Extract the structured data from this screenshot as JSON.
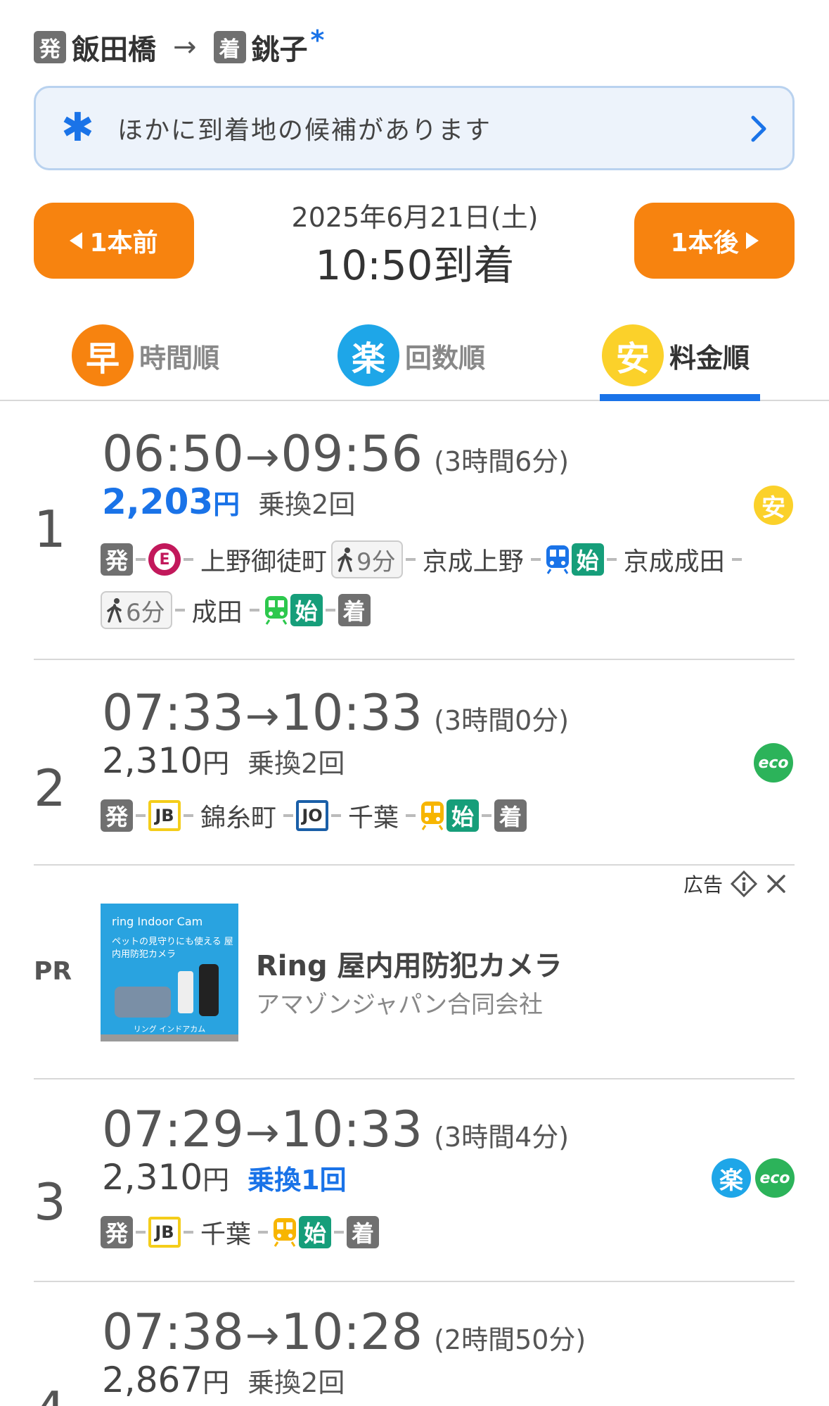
{
  "header": {
    "dep_badge": "発",
    "from": "飯田橋",
    "arrow": "→",
    "arr_badge": "着",
    "to": "銚子",
    "star": "*"
  },
  "banner": {
    "icon": "asterisk-icon",
    "text": "ほかに到着地の候補があります"
  },
  "nav": {
    "prev_label": "1本前",
    "next_label": "1本後",
    "date": "2025年6月21日(土)",
    "arrival": "10:50到着"
  },
  "tabs": [
    {
      "icon_char": "早",
      "label": "時間順",
      "color": "#f7830f"
    },
    {
      "icon_char": "楽",
      "label": "回数順",
      "color": "#1ea6e8"
    },
    {
      "icon_char": "安",
      "label": "料金順",
      "color": "#fbd12a",
      "active": true
    }
  ],
  "routes": [
    {
      "num": "1",
      "dep": "06:50",
      "arrow": "→",
      "arr": "09:56",
      "duration": "(3時間6分)",
      "fare": "2,203",
      "yen": "円",
      "transfers": "乗換2回",
      "tags": [
        "安"
      ],
      "seg_line1": {
        "dep": "発",
        "e_line": "E",
        "st1": "上野御徒町",
        "walk1": "9分",
        "st2": "京成上野",
        "start": "始",
        "st3": "京成成田"
      },
      "seg_line2": {
        "walk2": "6分",
        "st4": "成田",
        "start": "始",
        "arr": "着"
      }
    },
    {
      "num": "2",
      "dep": "07:33",
      "arrow": "→",
      "arr": "10:33",
      "duration": "(3時間0分)",
      "fare": "2,310",
      "yen": "円",
      "transfers": "乗換2回",
      "tags": [
        "eco"
      ],
      "seg": {
        "dep": "発",
        "jb": "JB",
        "st1": "錦糸町",
        "jo": "JO",
        "st2": "千葉",
        "start": "始",
        "arr": "着"
      }
    },
    {
      "num": "3",
      "dep": "07:29",
      "arrow": "→",
      "arr": "10:33",
      "duration": "(3時間4分)",
      "fare": "2,310",
      "yen": "円",
      "transfers": "乗換1回",
      "tags": [
        "楽",
        "eco"
      ],
      "seg": {
        "dep": "発",
        "jb": "JB",
        "st1": "千葉",
        "start": "始",
        "arr": "着"
      }
    },
    {
      "num": "4",
      "dep": "07:38",
      "arrow": "→",
      "arr": "10:28",
      "duration": "(2時間50分)",
      "fare": "2,867",
      "yen": "円",
      "transfers": "乗換2回"
    }
  ],
  "ad": {
    "label": "広告",
    "pr": "PR",
    "title": "Ring 屋内用防犯カメラ",
    "advertiser": "アマゾンジャパン合同会社",
    "img_brand": "ring Indoor Cam",
    "img_copy": "ペットの見守りにも使える 屋内用防犯カメラ",
    "img_foot": "リング インドアカム"
  }
}
